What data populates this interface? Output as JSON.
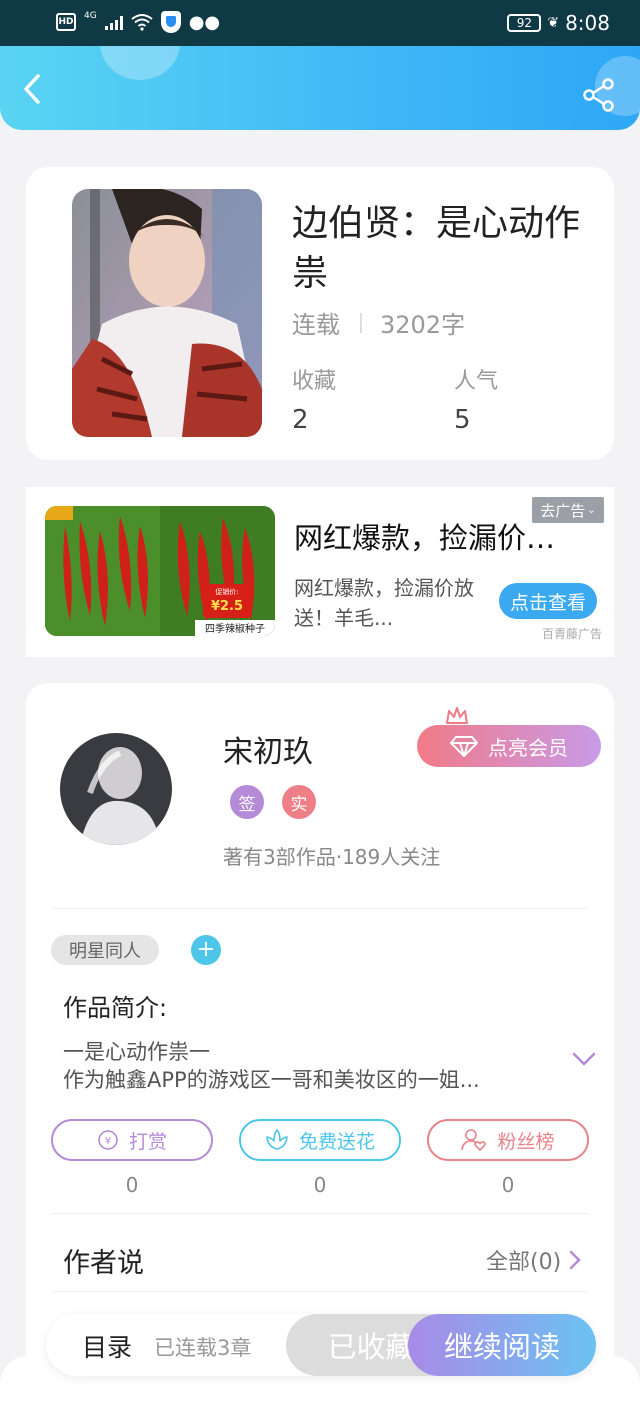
{
  "status_bar": {
    "hd": "HD",
    "network": "4G",
    "battery": "92",
    "time": "8:08"
  },
  "book": {
    "title": "边伯贤：是心动作祟",
    "status": "连载",
    "word_count": "3202字",
    "stats": [
      {
        "label": "收藏",
        "value": "2"
      },
      {
        "label": "人气",
        "value": "5"
      }
    ]
  },
  "ad": {
    "title": "网红爆款，捡漏价放送！羊毛...",
    "description": "网红爆款，捡漏价放送！羊毛...",
    "button": "点击查看",
    "close_tag": "去广告",
    "source": "百青藤广告",
    "image_price_label": "促销价:",
    "image_price": "¥2.5",
    "image_caption": "四季辣椒种子"
  },
  "author": {
    "name": "宋初玖",
    "badges": [
      "签",
      "实"
    ],
    "stats": "著有3部作品·189人关注",
    "vip_button": "点亮会员"
  },
  "tags": [
    "明星同人"
  ],
  "intro": {
    "label": "作品简介:",
    "line1": "一是心动作祟一",
    "line2": "作为触鑫APP的游戏区一哥和美妆区的一姐..."
  },
  "actions": [
    {
      "label": "打赏",
      "count": "0",
      "color": "#b58ad6"
    },
    {
      "label": "免费送花",
      "count": "0",
      "color": "#4ec6ea"
    },
    {
      "label": "粉丝榜",
      "count": "0",
      "color": "#e9838a"
    }
  ],
  "author_says": {
    "label": "作者说",
    "all": "全部(0)"
  },
  "bottom_bar": {
    "toc": "目录",
    "chapters": "已连载3章",
    "collected": "已收藏",
    "continue": "继续阅读"
  },
  "colors": {
    "header_start": "#5ad4f2",
    "header_end": "#2ea7f6",
    "accent_purple": "#a88ae8",
    "accent_blue": "#3aa9f0"
  }
}
